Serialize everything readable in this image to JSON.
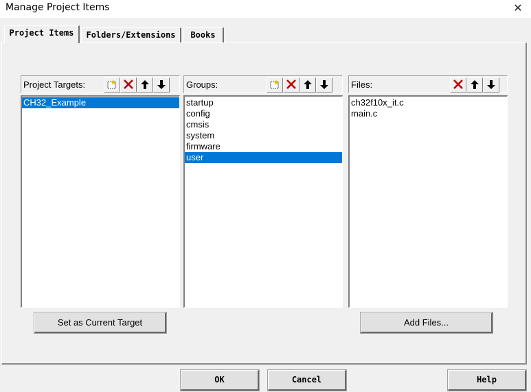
{
  "window": {
    "title": "Manage Project Items",
    "close_glyph": "✕"
  },
  "tabs": [
    {
      "label": "Project Items",
      "active": true
    },
    {
      "label": "Folders/Extensions",
      "active": false
    },
    {
      "label": "Books",
      "active": false
    }
  ],
  "targets_panel": {
    "label": "Project Targets:",
    "tools": [
      "new-icon",
      "delete-icon",
      "move-up-icon",
      "move-down-icon"
    ],
    "items": [
      "CH32_Example"
    ],
    "selected": "CH32_Example",
    "button_label": "Set as Current Target"
  },
  "groups_panel": {
    "label": "Groups:",
    "tools": [
      "new-icon",
      "delete-icon",
      "move-up-icon",
      "move-down-icon"
    ],
    "items": [
      "startup",
      "config",
      "cmsis",
      "system",
      "firmware",
      "user"
    ],
    "selected": "user"
  },
  "files_panel": {
    "label": "Files:",
    "tools": [
      "delete-icon",
      "move-up-icon",
      "move-down-icon"
    ],
    "items": [
      "ch32f10x_it.c",
      "main.c"
    ],
    "button_label": "Add Files..."
  },
  "footer": {
    "ok_label": "OK",
    "cancel_label": "Cancel",
    "help_label": "Help"
  },
  "colors": {
    "selection": "#0078d7",
    "delete_red": "#c00000",
    "dialog_bg": "#f0f0f0"
  }
}
